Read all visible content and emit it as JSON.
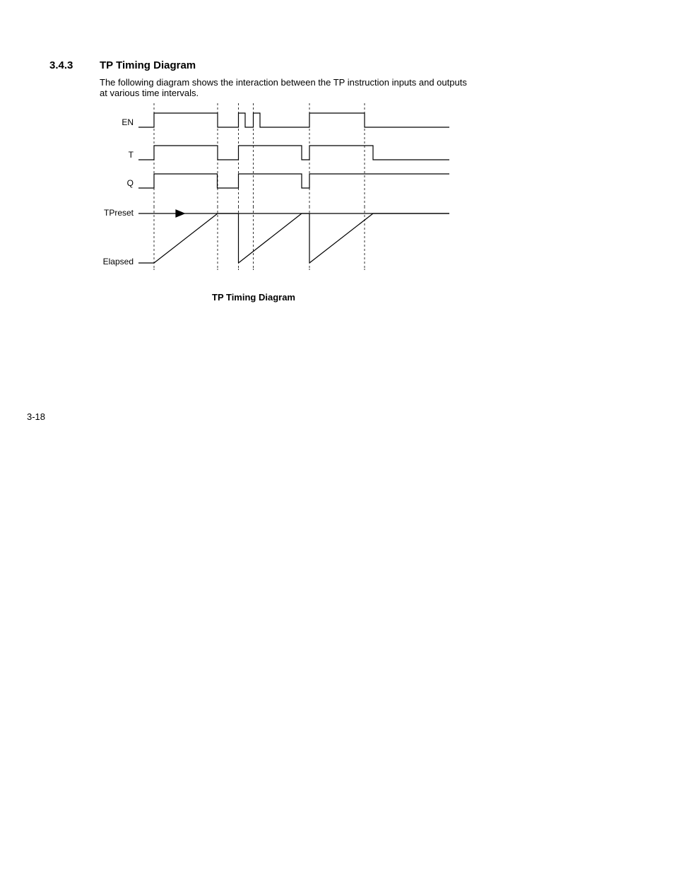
{
  "section": {
    "number": "3.4.3",
    "title": "TP Timing Diagram"
  },
  "paragraph": "The following diagram shows the interaction between the TP instruction inputs and outputs at various time intervals.",
  "diagram": {
    "signals": {
      "en": "EN",
      "t": "T",
      "q": "Q",
      "tpreset": "TPreset",
      "elapsed": "Elapsed"
    },
    "caption": "TP Timing Diagram"
  },
  "page_number": "3-18"
}
